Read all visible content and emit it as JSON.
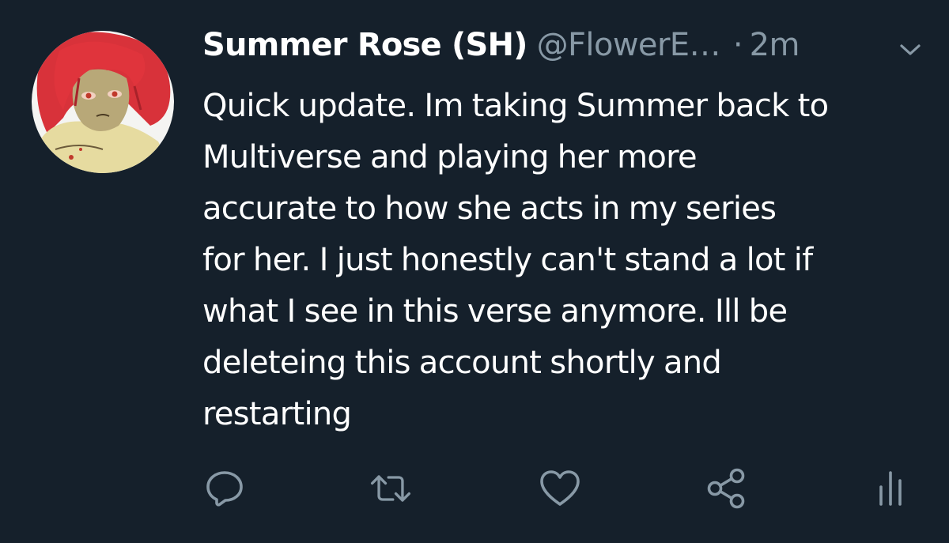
{
  "tweet": {
    "author_name": "Summer Rose (SH)",
    "handle": "@FlowerE…",
    "separator": "·",
    "time": "2m",
    "text": "Quick update. Im taking Summer back to\nMultiverse and playing her more\naccurate to how she acts in my series\nfor her. I just honestly can't stand a lot if\nwhat I see in this verse anymore. Ill be\ndeleteing this account shortly and\nrestarting"
  },
  "actions": [
    {
      "icon": "reply-icon"
    },
    {
      "icon": "retweet-icon"
    },
    {
      "icon": "like-icon"
    },
    {
      "icon": "share-icon"
    },
    {
      "icon": "analytics-icon"
    }
  ],
  "colors": {
    "background": "#15202b",
    "text_primary": "#ffffff",
    "text_secondary": "#8899a6"
  }
}
